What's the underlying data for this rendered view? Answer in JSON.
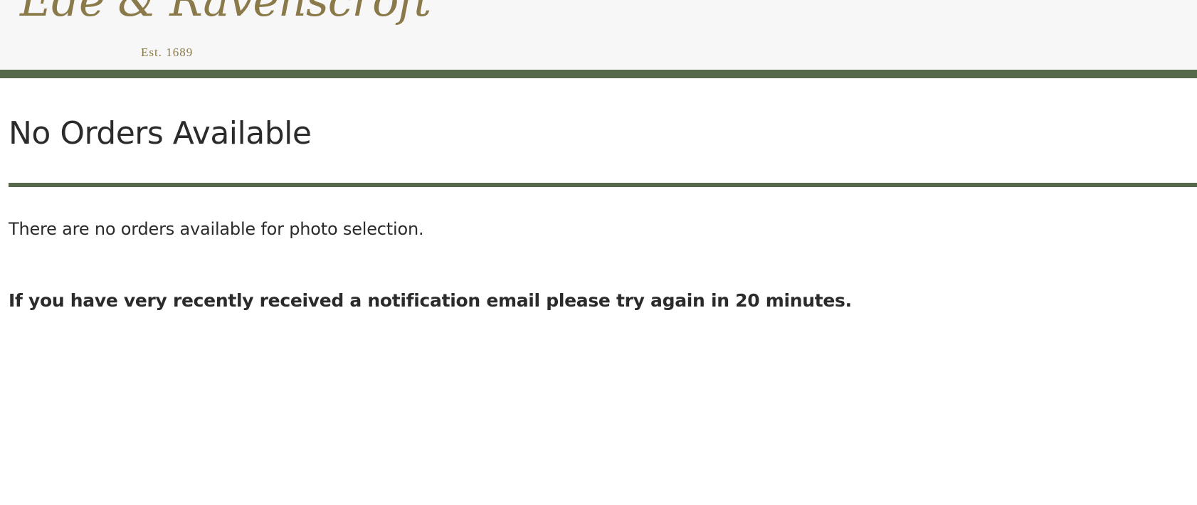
{
  "header": {
    "logo_text": "Ede & Ravenscroft",
    "logo_tagline": "Est. 1689"
  },
  "main": {
    "title": "No Orders Available",
    "message": "There are no orders available for photo selection.",
    "notice": "If you have very recently received a notification email please try again in 20 minutes."
  },
  "colors": {
    "accent": "#56694a",
    "logo_gold": "#8a7a4a",
    "header_bg": "#f7f7f7",
    "text": "#2b2b2b"
  }
}
